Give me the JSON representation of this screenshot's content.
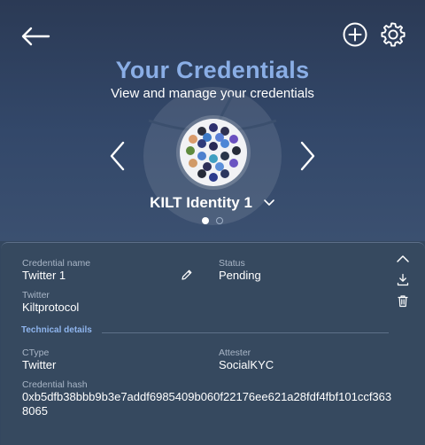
{
  "header": {
    "title": "Your Credentials",
    "subtitle": "View and manage your credentials"
  },
  "identity": {
    "name": "KILT Identity 1",
    "page_count": 2,
    "active_page": 1
  },
  "credential": {
    "name_label": "Credential name",
    "name_value": "Twitter 1",
    "status_label": "Status",
    "status_value": "Pending",
    "twitter_label": "Twitter",
    "twitter_value": "Kiltprotocol",
    "technical_details_label": "Technical details",
    "ctype_label": "CType",
    "ctype_value": "Twitter",
    "attester_label": "Attester",
    "attester_value": "SocialKYC",
    "hash_label": "Credential hash",
    "hash_value": "0xb5dfb38bbb9b3e7addf6985409b060f22176ee621a28fdf4fbf101ccf3638065"
  },
  "colors": {
    "accent": "#8aaee6",
    "link": "#8fb5ee",
    "panel": "#36495f",
    "header_top": "#2b3a55"
  },
  "icons": [
    "back-arrow-icon",
    "add-circle-icon",
    "gear-icon",
    "chevron-left-icon",
    "chevron-right-icon",
    "chevron-down-icon",
    "pencil-icon",
    "chevron-up-icon",
    "download-icon",
    "trash-icon"
  ]
}
